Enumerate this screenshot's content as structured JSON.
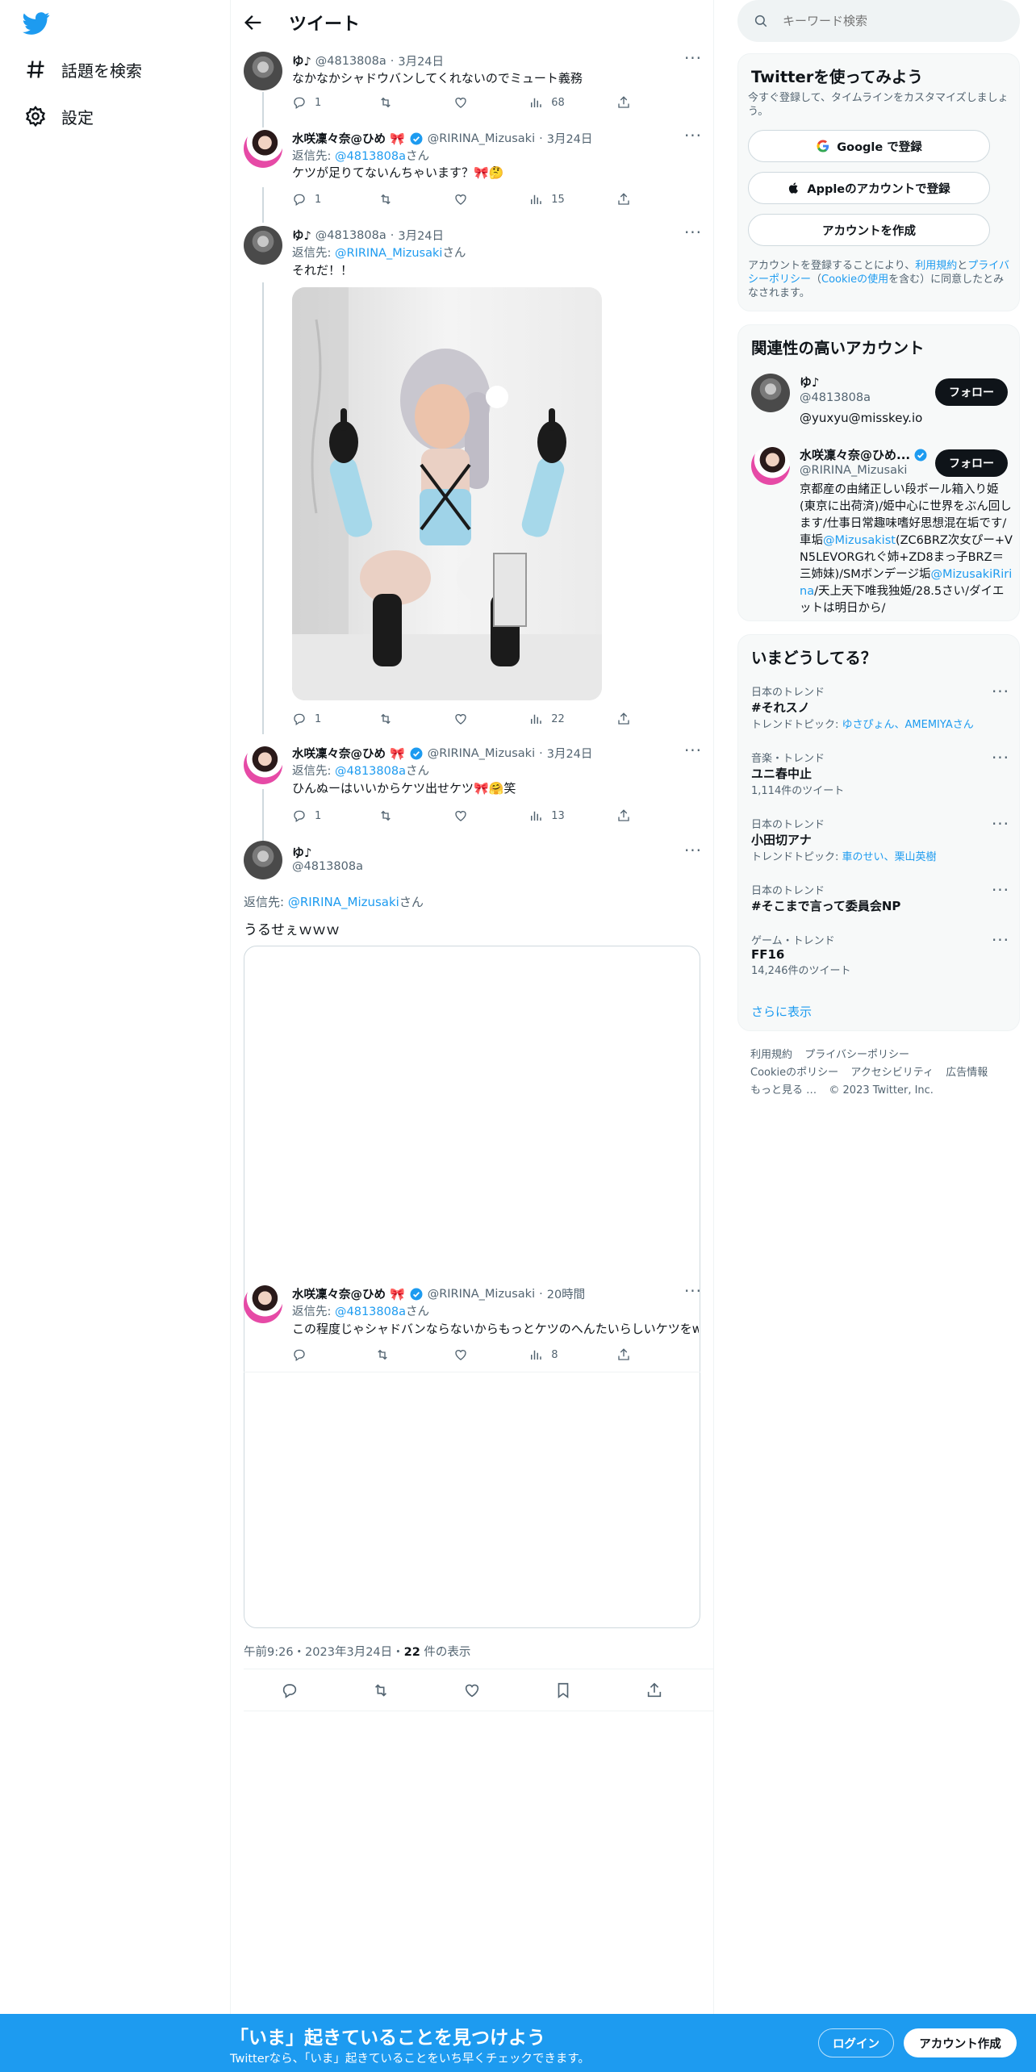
{
  "nav": {
    "explore_label": "話題を検索",
    "settings_label": "設定"
  },
  "header": {
    "title": "ツイート"
  },
  "thread": [
    {
      "name": "ゆ♪",
      "handle": "@4813808a",
      "date": "3月24日",
      "reply_to_prefix": "",
      "reply_to": "",
      "reply_to_suffix": "",
      "text": "なかなかシャドウバンしてくれないのでミュート義務",
      "replies": "1",
      "views": "68"
    },
    {
      "name": "水咲凜々奈@ひめ",
      "handle": "@RIRINA_Mizusaki",
      "date": "3月24日",
      "reply_to_prefix": "返信先: ",
      "reply_to": "@4813808a",
      "reply_to_suffix": "さん",
      "text": "ケツが足りてないんちゃいます？🎀🤔",
      "replies": "1",
      "views": "15"
    },
    {
      "name": "ゆ♪",
      "handle": "@4813808a",
      "date": "3月24日",
      "reply_to_prefix": "返信先: ",
      "reply_to": "@RIRINA_Mizusaki",
      "reply_to_suffix": "さん",
      "text": "それだ！！",
      "replies": "1",
      "views": "22"
    },
    {
      "name": "水咲凜々奈@ひめ",
      "handle": "@RIRINA_Mizusaki",
      "date": "3月24日",
      "reply_to_prefix": "返信先: ",
      "reply_to": "@4813808a",
      "reply_to_suffix": "さん",
      "text": "ひんぬーはいいからケツ出せケツ🎀🤗笑",
      "replies": "1",
      "views": "13"
    }
  ],
  "main_tweet": {
    "name": "ゆ♪",
    "handle": "@4813808a",
    "reply_to_prefix": "返信先: ",
    "reply_to": "@RIRINA_Mizusaki",
    "reply_to_suffix": "さん",
    "text": "うるせぇｗｗｗ",
    "timestamp": "午前9:26・2023年3月24日・",
    "views_count": "22",
    "views_label": " 件の表示"
  },
  "embedded_tweet": {
    "name": "水咲凜々奈@ひめ",
    "handle": "@RIRINA_Mizusaki",
    "date": "20時間",
    "reply_to_prefix": "返信先: ",
    "reply_to": "@4813808a",
    "reply_to_suffix": "さん",
    "text": "この程度じゃシャドバンならないからもっとケツのへんたいらしいケツをw",
    "views": "8"
  },
  "search": {
    "placeholder": "キーワード検索"
  },
  "signup_card": {
    "title": "Twitterを使ってみよう",
    "subtitle": "今すぐ登録して、タイムラインをカスタマイズしましょう。",
    "google_label": "Google で登録",
    "apple_label": "Appleのアカウントで登録",
    "create_label": "アカウントを作成",
    "terms_pre": "アカウントを登録することにより、",
    "terms_link": "利用規約",
    "terms_and": "と",
    "privacy_link": "プライバシーポリシー",
    "cookie_open": "（",
    "cookie_link": "Cookieの使用",
    "cookie_close": "を含む）に同意したとみなされます。"
  },
  "related": {
    "title": "関連性の高いアカウント",
    "accounts": [
      {
        "name": "ゆ♪",
        "handle": "@4813808a",
        "bio": "@yuxyu@misskey.io",
        "follow_label": "フォロー"
      },
      {
        "name": "水咲凜々奈@ひめ...",
        "handle": "@RIRINA_Mizusaki",
        "follow_label": "フォロー",
        "bio_1": "京都産の由緒正しい段ボール箱入り姫(東京に出荷済)/姫中心に世界をぶん回します/仕事日常趣味嗜好思想混在垢です/車垢",
        "bio_link_1": "@Mizusakist",
        "bio_2": "(ZC6BRZ次女ぴー+VN5LEVORGれぐ姉+ZD8まっ子BRZ＝三姉妹)/SMボンデージ垢",
        "bio_link_2": "@MizusakiRirina",
        "bio_3": "/天上天下唯我独姫/28.5さい/ダイエットは明日から/"
      }
    ]
  },
  "trends": {
    "title": "いまどうしてる？",
    "items": [
      {
        "category": "日本のトレンド",
        "name": "#それスノ",
        "sub_prefix": "トレンドトピック: ",
        "sub_link": "ゆさぴょん、AMEMIYAさん",
        "sub": ""
      },
      {
        "category": "音楽・トレンド",
        "name": "ユニ春中止",
        "sub_prefix": "",
        "sub_link": "",
        "sub": "1,114件のツイート"
      },
      {
        "category": "日本のトレンド",
        "name": "小田切アナ",
        "sub_prefix": "トレンドトピック: ",
        "sub_link": "車のせい、栗山英樹",
        "sub": ""
      },
      {
        "category": "日本のトレンド",
        "name": "#そこまで言って委員会NP",
        "sub_prefix": "",
        "sub_link": "",
        "sub": ""
      },
      {
        "category": "ゲーム・トレンド",
        "name": "FF16",
        "sub_prefix": "",
        "sub_link": "",
        "sub": "14,246件のツイート"
      }
    ],
    "show_more": "さらに表示"
  },
  "footer": {
    "terms": "利用規約",
    "privacy": "プライバシーポリシー",
    "cookie": "Cookieのポリシー",
    "accessibility": "アクセシビリティ",
    "ads": "広告情報",
    "more": "もっと見る …",
    "copyright": "© 2023 Twitter, Inc."
  },
  "banner": {
    "title": "「いま」起きていることを見つけよう",
    "subtitle": "Twitterなら、「いま」起きていることをいち早くチェックできます。",
    "login": "ログイン",
    "signup": "アカウント作成"
  },
  "colors": {
    "accent": "#1d9bf0",
    "text": "#0f1419",
    "muted": "#536471"
  }
}
